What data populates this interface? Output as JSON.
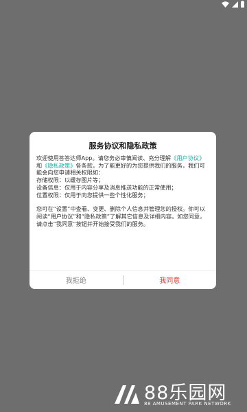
{
  "dialog": {
    "title": "服务协议和隐私政策",
    "intro_1": "欢迎使用答答达师App。请您务必审慎阅读、充分理解",
    "link_user_agreement": "《用户协议》",
    "intro_2": "和",
    "link_privacy_policy": "《隐私政策》",
    "intro_3": "各条款，为了能更好的为您提供我们的服务，我们可能会向您申请相关权限如：",
    "perm_storage": "存储权限：以缓存图片等；",
    "perm_device": "设备信息：仅用于内容分享及消息推送功能的正常使用；",
    "perm_location": "位置权限：仅用于向您提供一些个性化服务；",
    "para_2": "您可在“设置”中查看、变更、删除个人信息并管理您的授权。你可以阅读“用户协议”和“隐私政策”了解其它信息及详细内容。如您同意，请点击“我同意”按钮并开始接受我们的服务。",
    "reject_label": "我拒绝",
    "accept_label": "我同意"
  },
  "watermark": {
    "title": "88乐园网",
    "subtitle": "88 AMUSEMENT PARK NETWORK"
  },
  "colors": {
    "overlay": "#6e6e6e",
    "link": "#1aaea0",
    "accept": "#e03a36",
    "reject": "#888888"
  }
}
